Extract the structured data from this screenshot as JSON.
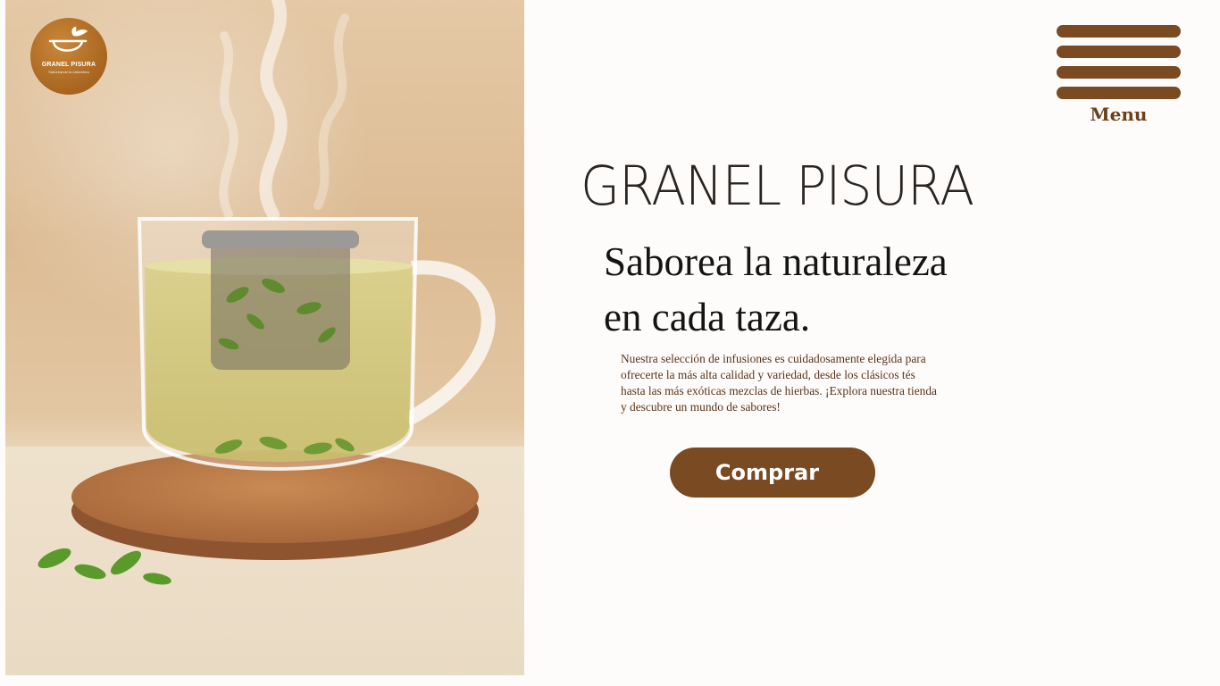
{
  "logo": {
    "brand": "GRANEL PISURA",
    "tagline": "Saboreando la naturaleza",
    "icon": "tea-cup-leaf-icon"
  },
  "menu": {
    "label": "Menu",
    "icon": "hamburger-icon"
  },
  "hero": {
    "title": "GRANEL PISURA",
    "tagline_line1": "Saborea la naturaleza",
    "tagline_line2": "en cada taza.",
    "description_line1": "Nuestra selección de infusiones es cuidadosamente elegida para",
    "description_line2": "ofrecerte la más alta calidad y variedad, desde los clásicos tés",
    "description_line3": "hasta las más exóticas mezclas de hierbas. ¡Explora nuestra tienda",
    "description_line4": "y descubre un mundo de sabores!",
    "cta_label": "Comprar"
  },
  "colors": {
    "accent_brown": "#7a4a22",
    "logo_orange": "#b06b24",
    "text_dark": "#141414"
  }
}
